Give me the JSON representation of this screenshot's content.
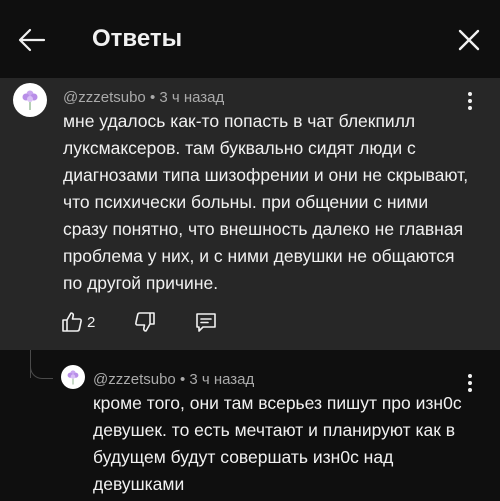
{
  "header": {
    "title": "Ответы",
    "back_icon": "arrow-left-icon",
    "close_icon": "close-icon"
  },
  "comment": {
    "author": "@zzzetsubo",
    "time": "3 ч назад",
    "text": "мне удалось как-то попасть в чат блекпилл луксмаксеров. там буквально сидят люди с диагнозами типа шизофрении и они не скрывают, что психически больны. при общении с ними сразу понятно, что внешность далеко не главная проблема у них, и с ними девушки не общаются по другой причине.",
    "like_count": "2",
    "menu_icon": "more-vert-icon"
  },
  "reply": {
    "author": "@zzzetsubo",
    "time": "3 ч назад",
    "text": "кроме того, они там всерьез пишут про изн0с девушек. то есть мечтают и планируют как в будущем будут совершать изн0с над девушками",
    "menu_icon": "more-vert-icon"
  },
  "colors": {
    "background": "#0f0f0f",
    "highlight": "#272727",
    "meta_text": "#aaaaaa",
    "text": "#f1f1f1",
    "avatar_flower": "#c9a6f0"
  }
}
